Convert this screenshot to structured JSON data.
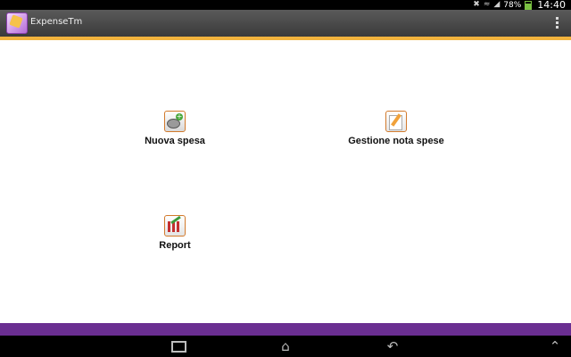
{
  "status_bar": {
    "battery_text": "78%",
    "battery_level": 0.78,
    "time": "14:40",
    "icons": [
      "mute-icon",
      "wifi-icon",
      "signal-icon",
      "battery-icon"
    ]
  },
  "app_bar": {
    "title": "ExpenseTm",
    "accent_color": "#f2b33d"
  },
  "menu": {
    "items": [
      {
        "label": "Nuova spesa",
        "icon": "new-expense-icon"
      },
      {
        "label": "Gestione nota spese",
        "icon": "manage-expenses-icon"
      },
      {
        "label": "Report",
        "icon": "report-icon"
      }
    ]
  },
  "bottom_band_color": "#6a2e91",
  "nav_bar": {
    "buttons": [
      "recent-apps-icon",
      "home-icon",
      "back-icon",
      "up-icon"
    ]
  }
}
